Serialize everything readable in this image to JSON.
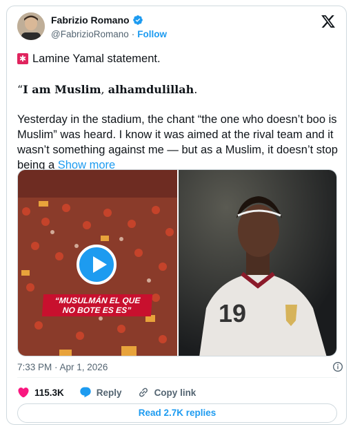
{
  "author": {
    "name": "Fabrizio Romano",
    "handle": "@FabrizioRomano",
    "separator": "·",
    "follow_label": "Follow",
    "verified_color": "#1d9bf0"
  },
  "tweet": {
    "line1": "Lamine Yamal statement.",
    "quote_open": "“",
    "quote_bold1": "I am Muslim",
    "quote_comma": ", ",
    "quote_bold2": "alhamdulillah",
    "quote_end": ".",
    "paragraph": "Yesterday in the stadium, the chant “the one who doesn’t boo is Muslim” was heard. I know it was aimed at the rival team and it wasn’t something against me — but as a Muslim, it doesn’t stop being a",
    "show_more": "Show more"
  },
  "media": {
    "video_caption_line1": "“MUSULMÁN EL QUE",
    "video_caption_line2": "NO BOTE ES ES”",
    "jersey_number": "19"
  },
  "meta": {
    "timestamp": "7:33 PM · Apr 1, 2026"
  },
  "actions": {
    "likes": "115.3K",
    "reply_label": "Reply",
    "copy_link_label": "Copy link"
  },
  "replies_button": "Read 2.7K replies",
  "colors": {
    "accent": "#1d9bf0",
    "like": "#f91880",
    "text": "#0f1419",
    "muted": "#536471"
  }
}
